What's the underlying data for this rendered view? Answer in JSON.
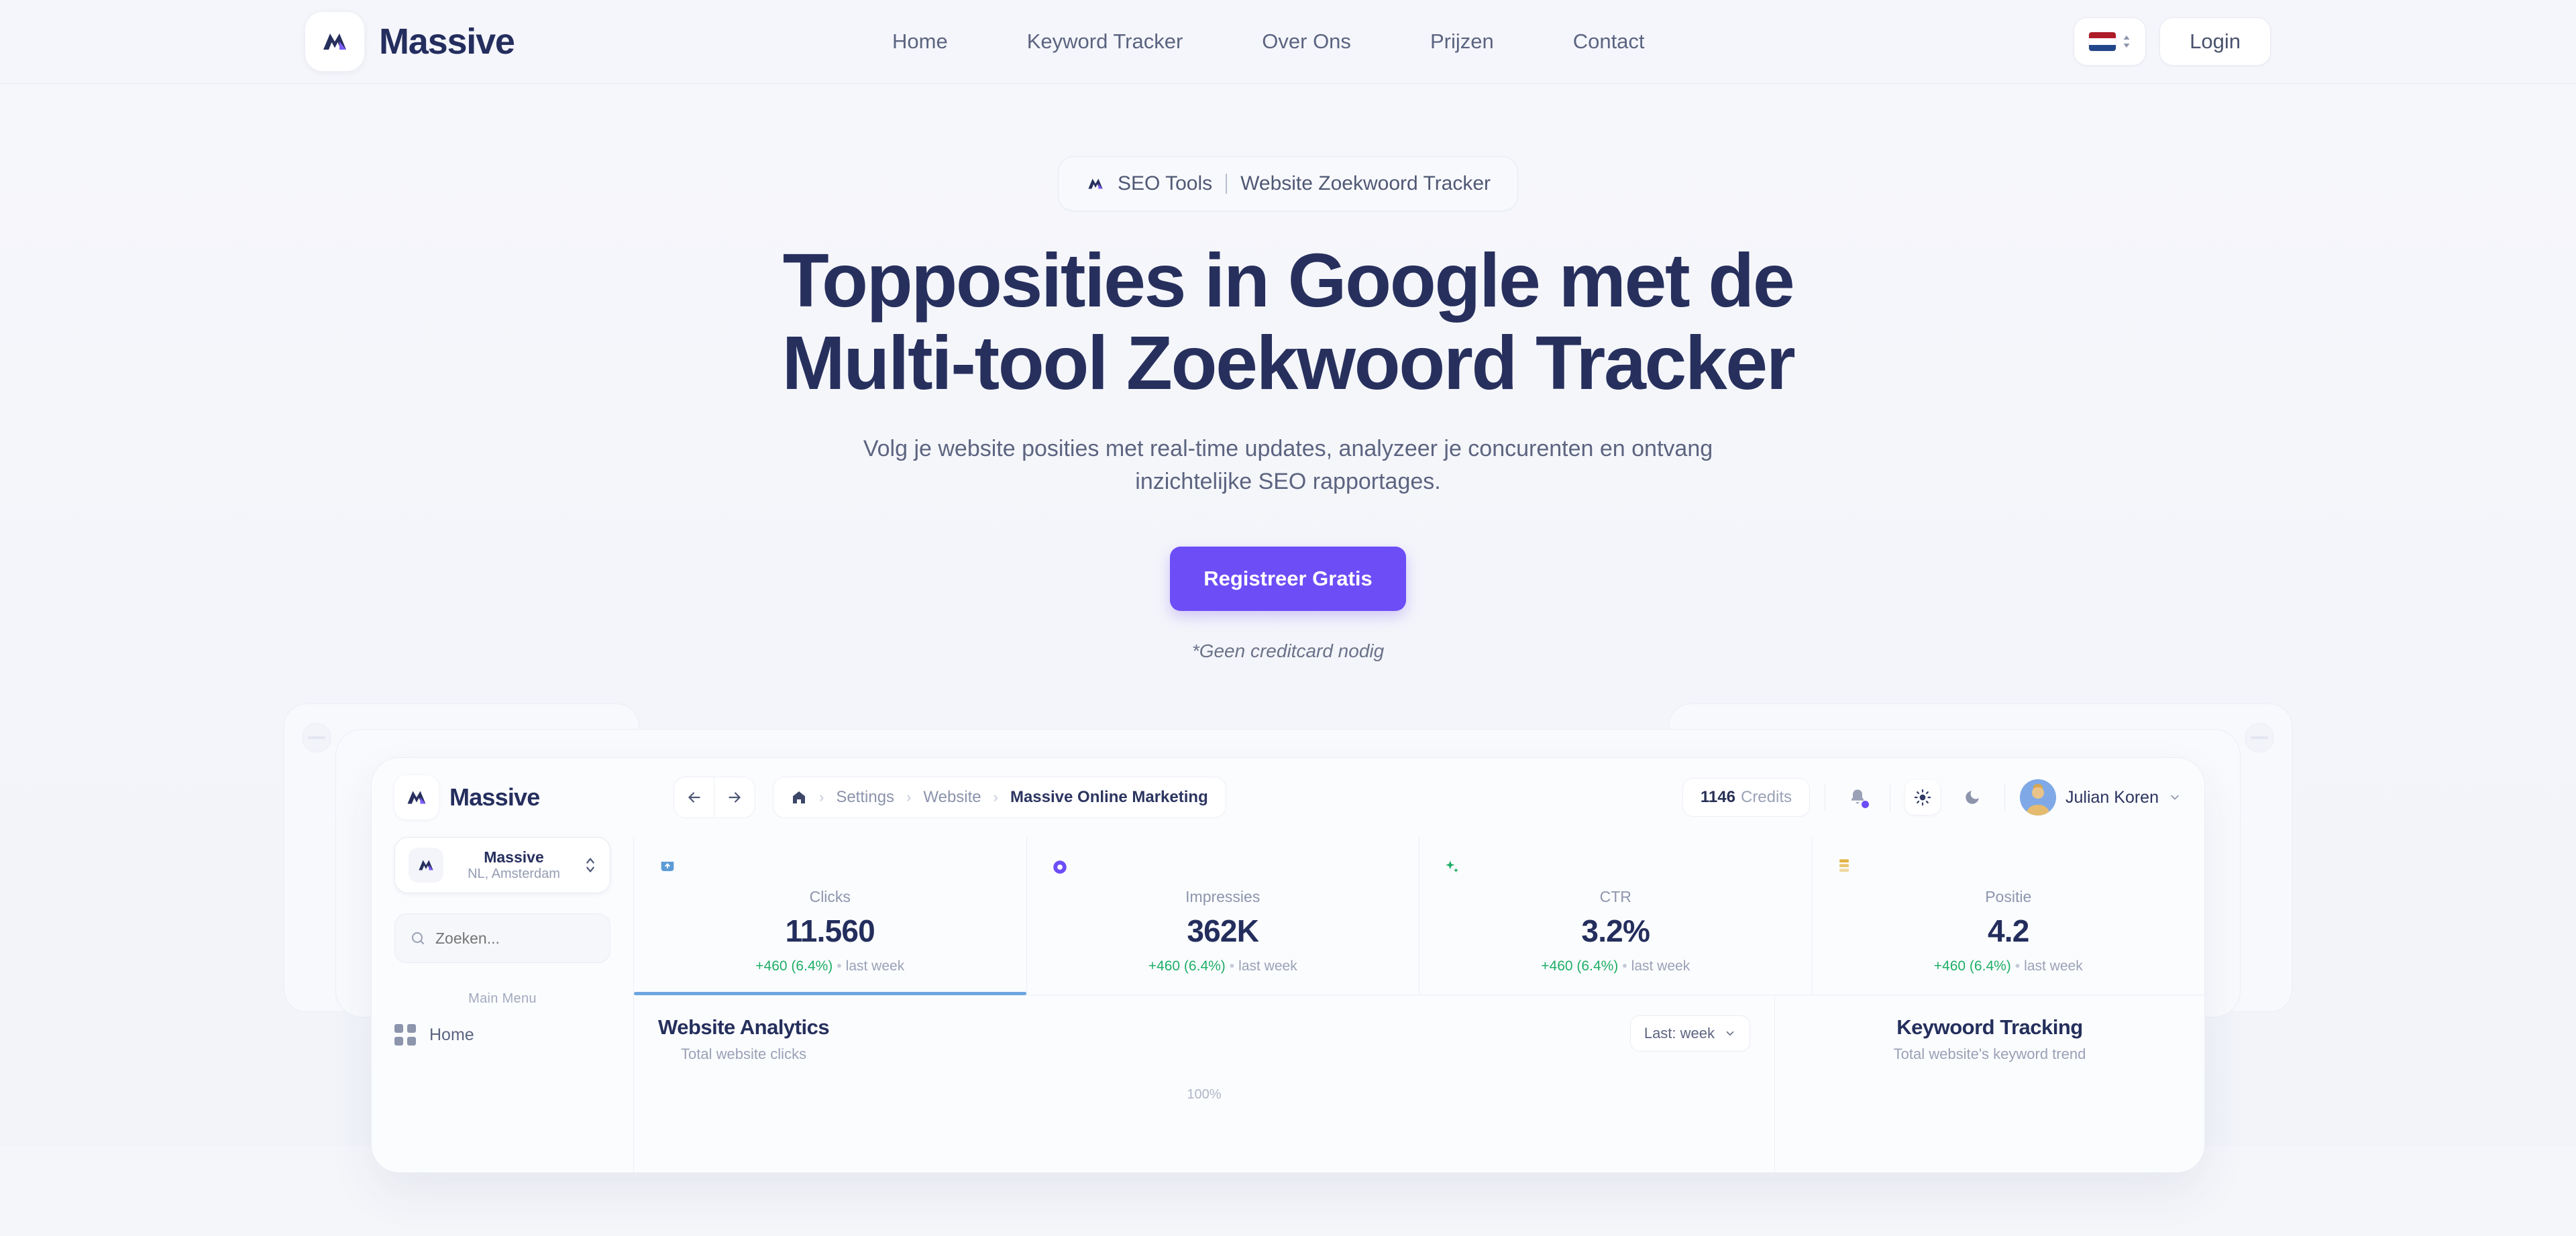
{
  "site": {
    "brand": "Massive",
    "logo_icon": "massive-m-logo"
  },
  "nav": {
    "links": [
      {
        "label": "Home"
      },
      {
        "label": "Keyword Tracker"
      },
      {
        "label": "Over Ons"
      },
      {
        "label": "Prijzen"
      },
      {
        "label": "Contact"
      }
    ],
    "language": {
      "code": "NL",
      "flag": "flag-nl-icon",
      "chevron": "up-down-chevron-icon"
    },
    "login_label": "Login"
  },
  "hero": {
    "badge_icon": "massive-m-logo",
    "badge_left": "SEO Tools",
    "badge_right": "Website Zoekwoord Tracker",
    "headline_line1": "Topposities in Google met de",
    "headline_line2": "Multi-tool Zoekwoord Tracker",
    "subhead": "Volg je website posities met real-time updates, analyzeer je concurenten en ontvang inzichtelijke SEO rapportages.",
    "cta_label": "Registreer Gratis",
    "note": "*Geen creditcard nodig"
  },
  "app": {
    "brand": "Massive",
    "nav_back_icon": "arrow-left-icon",
    "nav_forward_icon": "arrow-right-icon",
    "breadcrumb": {
      "home_icon": "home-icon",
      "items": [
        "Settings",
        "Website",
        "Massive Online Marketing"
      ],
      "separator": "›"
    },
    "credits_value": "1146",
    "credits_label": "Credits",
    "notification_icon": "bell-icon",
    "theme_light_icon": "sun-icon",
    "theme_dark_icon": "moon-icon",
    "user_name": "Julian Koren",
    "user_chevron": "chevron-down-icon",
    "sidebar": {
      "workspace_name": "Massive",
      "workspace_location": "NL, Amsterdam",
      "workspace_switch_icon": "up-down-chevron-icon",
      "search_icon": "search-icon",
      "search_placeholder": "Zoeken...",
      "search_value": "",
      "section_label": "Main Menu",
      "items": [
        {
          "label": "Home",
          "icon": "grid-icon"
        }
      ]
    },
    "stats": [
      {
        "label": "Clicks",
        "value": "11.560",
        "delta": "+460 (6.4%)",
        "period": "last week",
        "icon": "clicks-icon",
        "icon_color": "#5b9bd5",
        "active": true
      },
      {
        "label": "Impressies",
        "value": "362K",
        "delta": "+460 (6.4%)",
        "period": "last week",
        "icon": "impressions-eye-icon",
        "icon_color": "#6d4df6",
        "active": false
      },
      {
        "label": "CTR",
        "value": "3.2%",
        "delta": "+460 (6.4%)",
        "period": "last week",
        "icon": "sparkle-icon",
        "icon_color": "#1eae67",
        "active": false
      },
      {
        "label": "Positie",
        "value": "4.2",
        "delta": "+460 (6.4%)",
        "period": "last week",
        "icon": "bars-icon",
        "icon_color": "#e3b341",
        "active": false
      }
    ],
    "analytics": {
      "title": "Website Analytics",
      "subtitle": "Total website clicks",
      "period_label": "Last: week",
      "period_chevron": "chevron-down-icon",
      "axis_top": "100%"
    },
    "tracking": {
      "title": "Keywoord Tracking",
      "subtitle": "Total website's keyword trend"
    }
  },
  "colors": {
    "accent": "#6d4df6",
    "ink": "#242e5d",
    "muted": "#8d95ad",
    "positive": "#1eae67",
    "page_bg": "#f5f6fa",
    "active_underline": "#6ca6e0"
  }
}
